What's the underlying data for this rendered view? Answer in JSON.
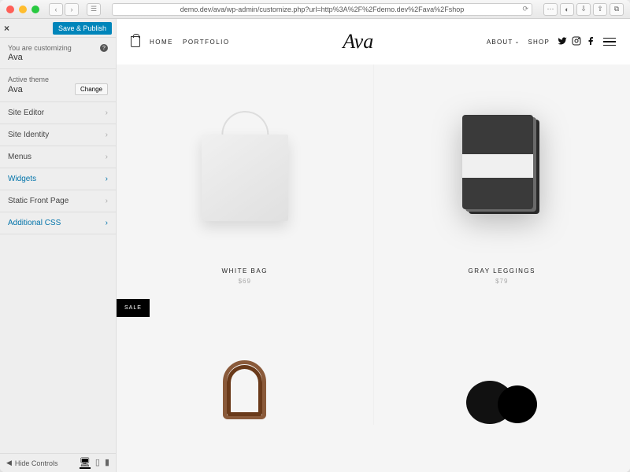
{
  "browser": {
    "url": "demo.dev/ava/wp-admin/customize.php?url=http%3A%2F%2Fdemo.dev%2Fava%2Fshop"
  },
  "customizer": {
    "save_label": "Save & Publish",
    "customizing_label": "You are customizing",
    "customizing_target": "Ava",
    "active_theme_label": "Active theme",
    "active_theme_name": "Ava",
    "change_label": "Change",
    "sections": [
      {
        "label": "Site Editor",
        "active": false
      },
      {
        "label": "Site Identity",
        "active": false
      },
      {
        "label": "Menus",
        "active": false
      },
      {
        "label": "Widgets",
        "active": true
      },
      {
        "label": "Static Front Page",
        "active": false
      },
      {
        "label": "Additional CSS",
        "active": true
      }
    ],
    "hide_controls_label": "Hide Controls"
  },
  "site": {
    "logo": "Ava",
    "nav_left": [
      "HOME",
      "PORTFOLIO"
    ],
    "nav_right": [
      {
        "label": "ABOUT",
        "dropdown": true
      },
      {
        "label": "SHOP",
        "dropdown": false
      }
    ],
    "products": [
      {
        "title": "WHITE BAG",
        "price": "$69",
        "badge": null
      },
      {
        "title": "GRAY LEGGINGS",
        "price": "$79",
        "badge": null
      },
      {
        "title": "",
        "price": "",
        "badge": "SALE"
      },
      {
        "title": "",
        "price": "",
        "badge": null
      }
    ]
  }
}
